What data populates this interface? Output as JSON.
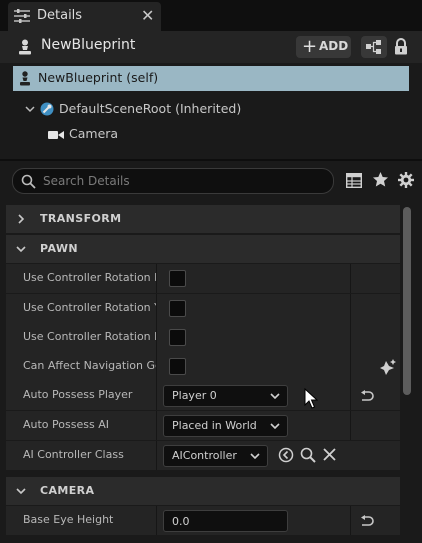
{
  "tab": {
    "label": "Details"
  },
  "header": {
    "title": "NewBlueprint",
    "add_label": "ADD"
  },
  "components": {
    "self_label": "NewBlueprint (self)",
    "root_label": "DefaultSceneRoot (Inherited)",
    "child_label": "Camera"
  },
  "search": {
    "placeholder": "Search Details"
  },
  "sections": {
    "transform": "TRANSFORM",
    "pawn": "PAWN",
    "camera": "CAMERA"
  },
  "properties": {
    "use_ctrl_rot_pitch": {
      "label": "Use Controller Rotation Pitch",
      "checked": false
    },
    "use_ctrl_rot_yaw": {
      "label": "Use Controller Rotation Yaw",
      "checked": false
    },
    "use_ctrl_rot_roll": {
      "label": "Use Controller Rotation Roll",
      "checked": false
    },
    "can_affect_nav": {
      "label": "Can Affect Navigation Generation",
      "checked": false
    },
    "auto_possess_player": {
      "label": "Auto Possess Player",
      "value": "Player 0"
    },
    "auto_possess_ai": {
      "label": "Auto Possess AI",
      "value": "Placed in World"
    },
    "ai_controller_class": {
      "label": "AI Controller Class",
      "value": "AIController"
    },
    "base_eye_height": {
      "label": "Base Eye Height",
      "value": "0.0"
    }
  },
  "icons": {
    "tab": "details-sliders-icon",
    "close": "close-icon",
    "blueprint": "pawn-icon",
    "lock": "lock-icon",
    "search": "search-icon",
    "table": "table-view-icon",
    "star": "star-icon",
    "gear": "gear-icon"
  },
  "colors": {
    "selection": "#9ab7c4",
    "panel": "#1a1a1a",
    "row": "#242424",
    "category": "#2b2b2b"
  }
}
